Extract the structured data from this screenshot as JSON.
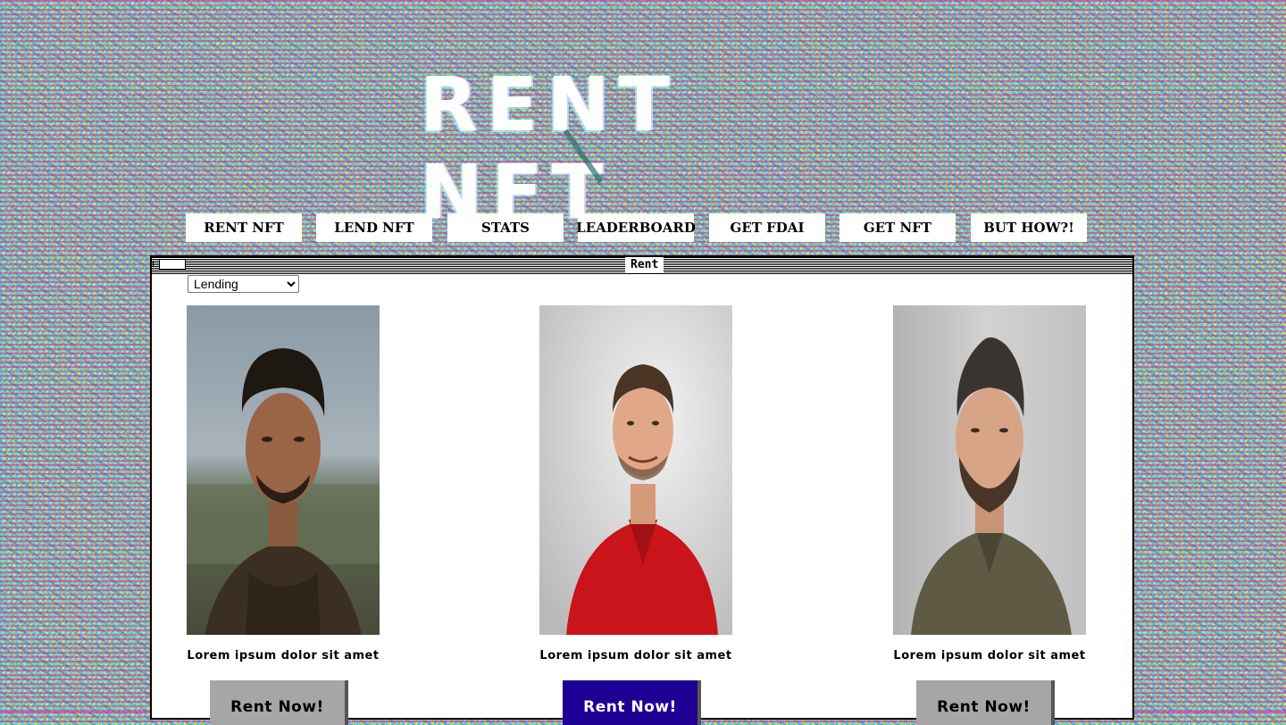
{
  "logo": {
    "text": "RENT NFT"
  },
  "nav": [
    {
      "label": "RENT NFT"
    },
    {
      "label": "LEND NFT"
    },
    {
      "label": "STATS"
    },
    {
      "label": "LEADERBOARD"
    },
    {
      "label": "GET FDAI"
    },
    {
      "label": "GET NFT"
    },
    {
      "label": "BUT HOW?!"
    }
  ],
  "window": {
    "title": "Rent",
    "mode_select": {
      "selected": "Lending",
      "options": [
        "Lending"
      ]
    }
  },
  "cards": [
    {
      "caption": "Lorem ipsum dolor sit amet",
      "button": "Rent Now!",
      "button_style": "gray"
    },
    {
      "caption": "Lorem ipsum dolor sit amet",
      "button": "Rent Now!",
      "button_style": "blue"
    },
    {
      "caption": "Lorem ipsum dolor sit amet",
      "button": "Rent Now!",
      "button_style": "gray"
    }
  ],
  "colors": {
    "window_bg": "#ffffff",
    "nav_bg": "#ffffff",
    "button_gray": "#a6a6a6",
    "button_active": "#1f0094"
  }
}
